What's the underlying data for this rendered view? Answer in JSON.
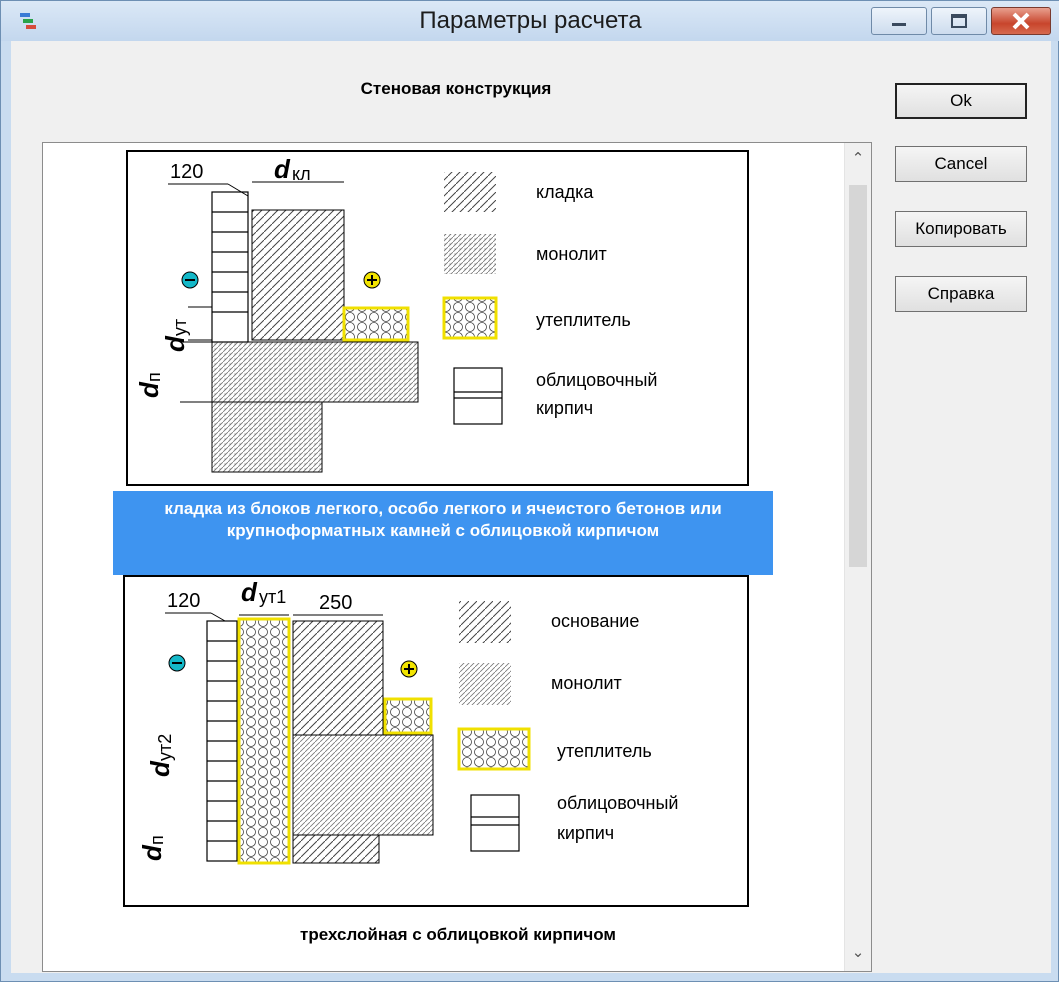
{
  "window": {
    "title": "Параметры расчета"
  },
  "heading": "Стеновая конструкция",
  "buttons": {
    "ok": "Ok",
    "cancel": "Cancel",
    "copy": "Копировать",
    "help": "Справка"
  },
  "items": [
    {
      "dim_width": "120",
      "dim_label": "d",
      "dim_label_sub": "кл",
      "dim_ins": "d",
      "dim_ins_sub": "ут",
      "dim_base": "d",
      "dim_base_sub": "п",
      "legend": {
        "masonry": "кладка",
        "monolith": "монолит",
        "insulation": "утеплитель",
        "facing_1": "облицовочный",
        "facing_2": "кирпич"
      },
      "caption": "кладка из блоков легкого, особо легкого и ячеистого бетонов или крупноформатных камней с облицовкой кирпичом",
      "selected": true
    },
    {
      "dim_width": "120",
      "dim_label": "d",
      "dim_label_sub": "ут1",
      "dim_250": "250",
      "dim_ins": "d",
      "dim_ins_sub": "ут2",
      "dim_base": "d",
      "dim_base_sub": "п",
      "legend": {
        "masonry": "основание",
        "monolith": "монолит",
        "insulation": "утеплитель",
        "facing_1": "облицовочный",
        "facing_2": "кирпич"
      },
      "caption": "трехслойная с облицовкой кирпичом",
      "selected": false
    }
  ]
}
